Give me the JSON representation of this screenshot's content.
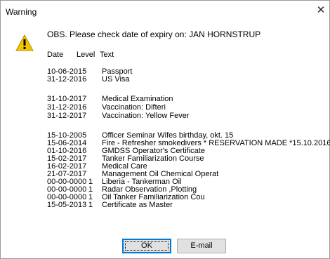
{
  "window": {
    "title": "Warning",
    "close_glyph": "✕"
  },
  "message": "OBS. Please check date of expiry on: JAN HORNSTRUP",
  "headers": {
    "date": "Date",
    "level": "Level",
    "text": "Text"
  },
  "rows": [
    {
      "date": "10-06-2015",
      "level": "",
      "text": "Passport"
    },
    {
      "date": "31-12-2016",
      "level": "",
      "text": "US Visa"
    },
    {
      "date": "31-10-2017",
      "level": "",
      "text": "Medical Examination"
    },
    {
      "date": "31-12-2016",
      "level": "",
      "text": "Vaccination: Difteri"
    },
    {
      "date": "31-12-2017",
      "level": "",
      "text": "Vaccination: Yellow Fever"
    },
    {
      "date": "15-10-2005",
      "level": "",
      "text": "Officer Seminar    Wifes birthday, okt. 15"
    },
    {
      "date": "15-06-2014",
      "level": "",
      "text": "Fire - Refresher smokedivers      * RESERVATION MADE *15.10.2016"
    },
    {
      "date": "01-10-2016",
      "level": "",
      "text": "GMDSS Operator's Certificate"
    },
    {
      "date": "15-02-2017",
      "level": "",
      "text": "Tanker Familiarization Course"
    },
    {
      "date": "16-02-2017",
      "level": "",
      "text": "Medical Care"
    },
    {
      "date": "21-07-2017",
      "level": "",
      "text": "Management Oil Chemical Operat"
    },
    {
      "date": "00-00-0000",
      "level": "1",
      "text": "Liberia - Tankerman Oil"
    },
    {
      "date": "00-00-0000",
      "level": "1",
      "text": "Radar Observation ,Plotting"
    },
    {
      "date": "00-00-0000",
      "level": "1",
      "text": "Oil Tanker Familiarization Cou"
    },
    {
      "date": "15-05-2013",
      "level": "1",
      "text": "Certificate as Master"
    }
  ],
  "buttons": {
    "ok": "OK",
    "email": "E-mail"
  },
  "icons": {
    "warning": "warning-icon",
    "close": "close-icon"
  },
  "colors": {
    "warning_fill": "#f5c400",
    "focus_border": "#0078d7",
    "button_bg": "#e1e1e1"
  }
}
